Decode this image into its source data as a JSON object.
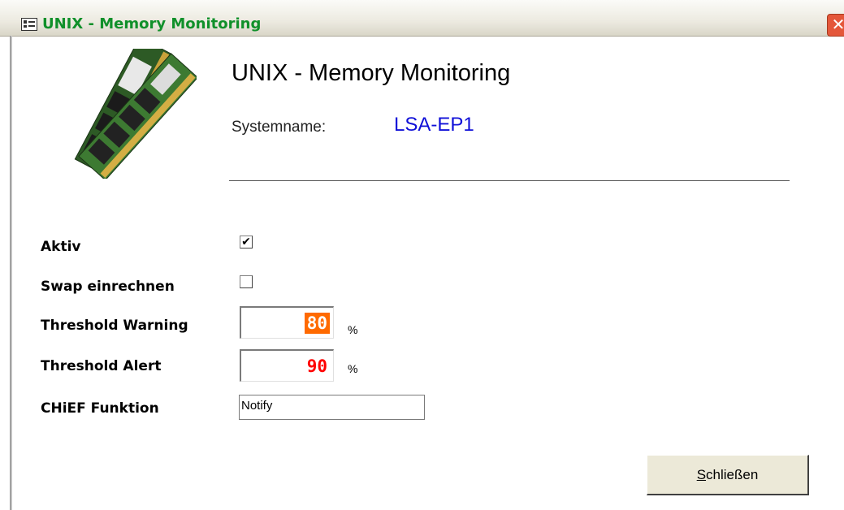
{
  "window": {
    "title": "UNIX - Memory Monitoring",
    "close_glyph": "✕"
  },
  "header": {
    "heading": "UNIX - Memory Monitoring",
    "systemname_label": "Systemname:",
    "systemname_value": "LSA-EP1",
    "image_icon": "ram-module-image"
  },
  "form": {
    "aktiv": {
      "label": "Aktiv",
      "checked": true,
      "mark": "✔"
    },
    "swap": {
      "label": "Swap einrechnen",
      "checked": false,
      "mark": ""
    },
    "warning": {
      "label": "Threshold Warning",
      "value": "80",
      "unit": "%"
    },
    "alert": {
      "label": "Threshold Alert",
      "value": "90",
      "unit": "%"
    },
    "chief": {
      "label": "CHiEF Funktion",
      "value": "Notify"
    }
  },
  "close_button": {
    "accesskey": "S",
    "rest": "chließen"
  },
  "colors": {
    "title_text": "#10902a",
    "systemname_value": "#1010d8",
    "warning_highlight": "#ff6a00",
    "alert_value": "#ff0000"
  }
}
